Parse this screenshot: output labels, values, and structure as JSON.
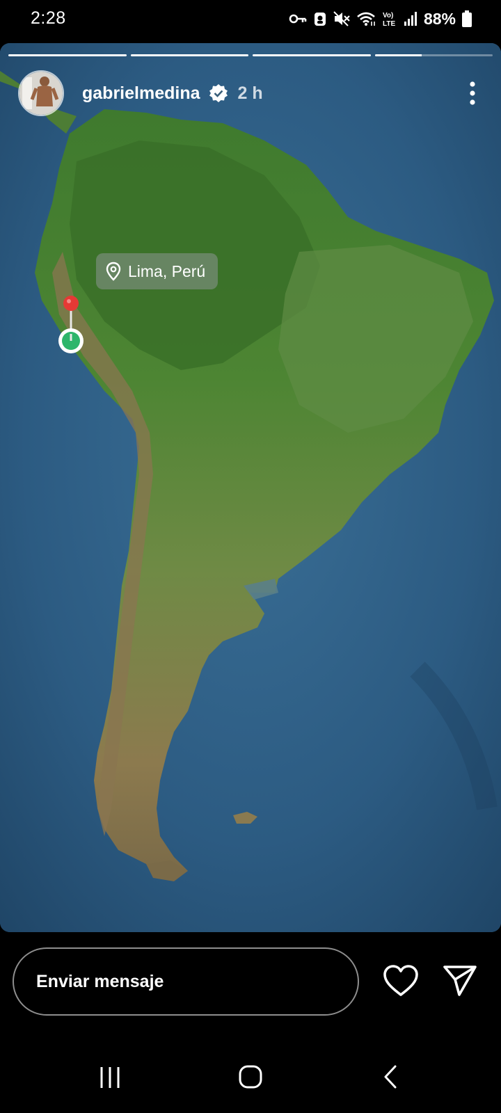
{
  "status_bar": {
    "time": "2:28",
    "battery": "88%",
    "icons": [
      "vpn-key-icon",
      "lock-icon",
      "mute-icon",
      "wifi-icon",
      "volte-icon",
      "signal-icon",
      "battery-icon"
    ],
    "volte_text": "Vo) LTE"
  },
  "story": {
    "progress": [
      1.0,
      1.0,
      1.0,
      0.4
    ],
    "username": "gabrielmedina",
    "verified": true,
    "time_ago": "2 h",
    "location_label": "Lima, Perú",
    "colors": {
      "ocean": "#2b5b83",
      "land": "#4f7f37",
      "pin_red": "#e53935",
      "pin_green": "#2db56b"
    }
  },
  "bottom_bar": {
    "message_placeholder": "Enviar mensaje",
    "like_icon": "heart-icon",
    "send_icon": "send-icon"
  },
  "nav_bar": {
    "icons": [
      "recent-apps-icon",
      "home-icon",
      "back-icon"
    ]
  }
}
